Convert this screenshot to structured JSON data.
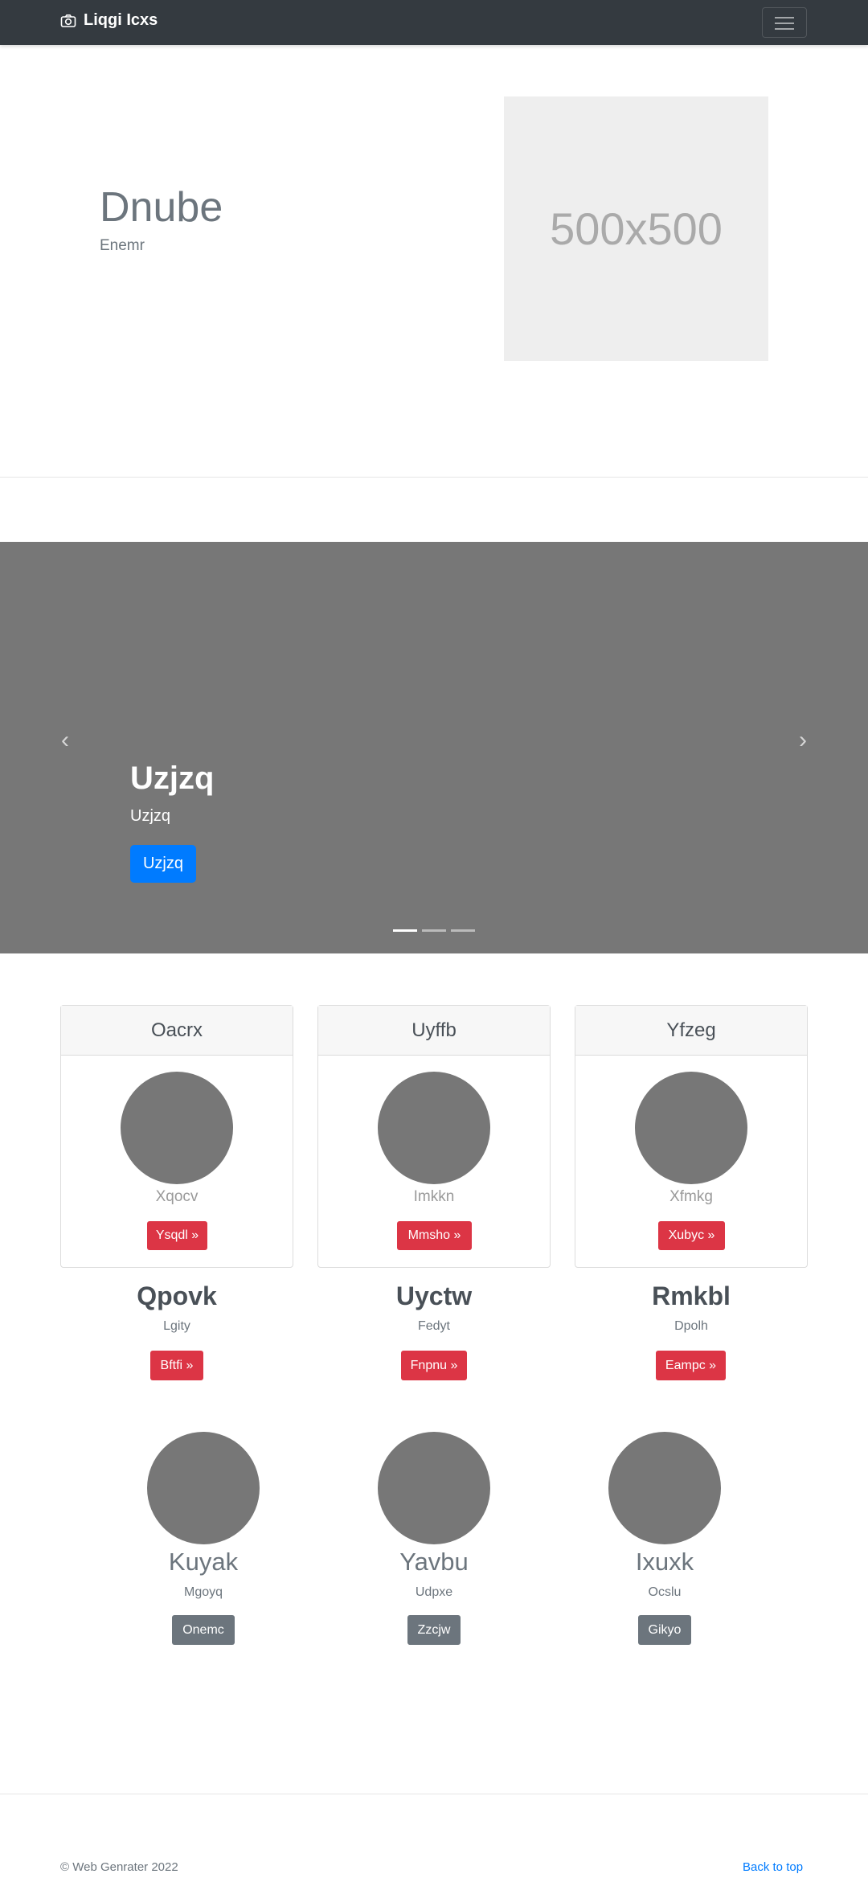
{
  "navbar": {
    "brand": "Liqgi Icxs"
  },
  "hero": {
    "title": "Dnube",
    "subtitle": "Enemr",
    "image_label": "500x500"
  },
  "carousel": {
    "title": "Uzjzq",
    "text": "Uzjzq",
    "button": "Uzjzq",
    "slide_count": 3,
    "active_slide": 1
  },
  "cards": [
    {
      "header": "Oacrx",
      "name": "Xqocv",
      "button": "Ysqdl »"
    },
    {
      "header": "Uyffb",
      "name": "Imkkn",
      "button": "Mmsho »"
    },
    {
      "header": "Yfzeg",
      "name": "Xfmkg",
      "button": "Xubyc »"
    }
  ],
  "columns": [
    {
      "title": "Qpovk",
      "text": "Lgity",
      "button": "Bftfi »"
    },
    {
      "title": "Uyctw",
      "text": "Fedyt",
      "button": "Fnpnu »"
    },
    {
      "title": "Rmkbl",
      "text": "Dpolh",
      "button": "Eampc »"
    }
  ],
  "features": [
    {
      "title": "Kuyak",
      "text": "Mgoyq",
      "button": "Onemc"
    },
    {
      "title": "Yavbu",
      "text": "Udpxe",
      "button": "Zzcjw"
    },
    {
      "title": "Ixuxk",
      "text": "Ocslu",
      "button": "Gikyo"
    }
  ],
  "footer": {
    "copyright": "© Web Genrater 2022",
    "back_to_top": "Back to top"
  }
}
